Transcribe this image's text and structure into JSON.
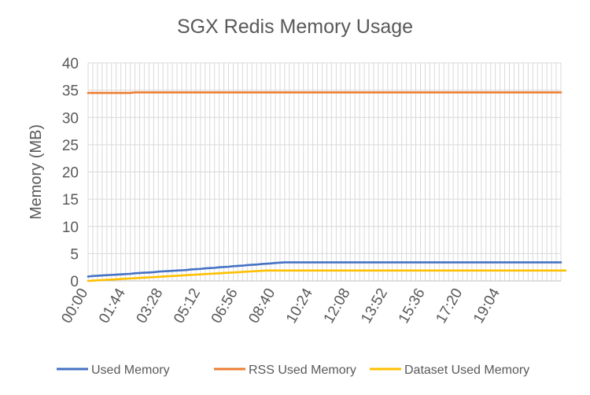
{
  "chart_data": {
    "type": "line",
    "title": "SGX Redis Memory Usage",
    "xlabel": "",
    "ylabel": "Memory (MB)",
    "ylim": [
      0,
      40
    ],
    "yticks": [
      "0",
      "5",
      "10",
      "15",
      "20",
      "25",
      "30",
      "35",
      "40"
    ],
    "grid": true,
    "legend_position": "bottom",
    "x_tick_labels": [
      "00:00",
      "01:44",
      "03:28",
      "05:12",
      "06:56",
      "08:40",
      "10:24",
      "12:08",
      "13:52",
      "15:36",
      "17:20",
      "19:04"
    ],
    "x_tick_interval_minutes": 104,
    "x_sample_interval_minutes": 13,
    "series": [
      {
        "name": "Used Memory",
        "color": "#4472C4",
        "values": [
          0.8,
          0.9,
          0.95,
          1.0,
          1.05,
          1.1,
          1.15,
          1.2,
          1.25,
          1.3,
          1.4,
          1.45,
          1.5,
          1.55,
          1.6,
          1.7,
          1.75,
          1.8,
          1.85,
          1.9,
          1.95,
          2.0,
          2.1,
          2.15,
          2.2,
          2.3,
          2.35,
          2.4,
          2.5,
          2.55,
          2.6,
          2.7,
          2.75,
          2.8,
          2.9,
          2.95,
          3.0,
          3.1,
          3.15,
          3.2,
          3.3,
          3.35,
          3.4,
          3.4,
          3.4,
          3.4,
          3.4,
          3.4,
          3.4,
          3.4,
          3.4,
          3.4,
          3.4,
          3.4,
          3.4,
          3.4,
          3.4,
          3.4,
          3.4,
          3.4,
          3.4,
          3.4,
          3.4,
          3.4,
          3.4,
          3.4,
          3.4,
          3.4,
          3.4,
          3.4,
          3.4,
          3.4,
          3.4,
          3.4,
          3.4,
          3.4,
          3.4,
          3.4,
          3.4,
          3.4,
          3.4,
          3.4,
          3.4,
          3.4,
          3.4,
          3.4,
          3.4,
          3.4,
          3.4,
          3.4,
          3.4,
          3.4,
          3.4,
          3.4,
          3.4,
          3.4,
          3.4,
          3.4,
          3.4,
          3.4,
          3.4,
          3.4
        ]
      },
      {
        "name": "RSS Used Memory",
        "color": "#ED7D31",
        "values": [
          34.5,
          34.5,
          34.5,
          34.5,
          34.5,
          34.5,
          34.5,
          34.5,
          34.5,
          34.5,
          34.6,
          34.6,
          34.6,
          34.6,
          34.6,
          34.6,
          34.6,
          34.6,
          34.6,
          34.6,
          34.6,
          34.6,
          34.6,
          34.6,
          34.6,
          34.6,
          34.6,
          34.6,
          34.6,
          34.6,
          34.6,
          34.6,
          34.6,
          34.6,
          34.6,
          34.6,
          34.6,
          34.6,
          34.6,
          34.6,
          34.6,
          34.6,
          34.6,
          34.6,
          34.6,
          34.6,
          34.6,
          34.6,
          34.6,
          34.6,
          34.6,
          34.6,
          34.6,
          34.6,
          34.6,
          34.6,
          34.6,
          34.6,
          34.6,
          34.6,
          34.6,
          34.6,
          34.6,
          34.6,
          34.6,
          34.6,
          34.6,
          34.6,
          34.6,
          34.6,
          34.6,
          34.6,
          34.6,
          34.6,
          34.6,
          34.6,
          34.6,
          34.6,
          34.6,
          34.6,
          34.6,
          34.6,
          34.6,
          34.6,
          34.6,
          34.6,
          34.6,
          34.6,
          34.6,
          34.6,
          34.6,
          34.6,
          34.6,
          34.6,
          34.6,
          34.6,
          34.6,
          34.6,
          34.6,
          34.6,
          34.6,
          34.6
        ]
      },
      {
        "name": "Dataset Used Memory",
        "color": "#FFC000",
        "values": [
          0.0,
          0.05,
          0.1,
          0.15,
          0.2,
          0.25,
          0.3,
          0.35,
          0.4,
          0.45,
          0.5,
          0.55,
          0.6,
          0.65,
          0.7,
          0.75,
          0.8,
          0.85,
          0.9,
          0.95,
          1.0,
          1.05,
          1.1,
          1.15,
          1.2,
          1.25,
          1.3,
          1.35,
          1.4,
          1.45,
          1.5,
          1.55,
          1.6,
          1.65,
          1.7,
          1.75,
          1.8,
          1.85,
          1.9,
          1.9,
          1.9,
          1.9,
          1.9,
          1.9,
          1.9,
          1.9,
          1.9,
          1.9,
          1.9,
          1.9,
          1.9,
          1.9,
          1.9,
          1.9,
          1.9,
          1.9,
          1.9,
          1.9,
          1.9,
          1.9,
          1.9,
          1.9,
          1.9,
          1.9,
          1.9,
          1.9,
          1.9,
          1.9,
          1.9,
          1.9,
          1.9,
          1.9,
          1.9,
          1.9,
          1.9,
          1.9,
          1.9,
          1.9,
          1.9,
          1.9,
          1.9,
          1.9,
          1.9,
          1.9,
          1.9,
          1.9,
          1.9,
          1.9,
          1.9,
          1.9,
          1.9,
          1.9,
          1.9,
          1.9,
          1.9,
          1.9,
          1.9,
          1.9,
          1.9,
          1.9,
          1.9,
          1.9,
          1.9
        ]
      }
    ]
  }
}
